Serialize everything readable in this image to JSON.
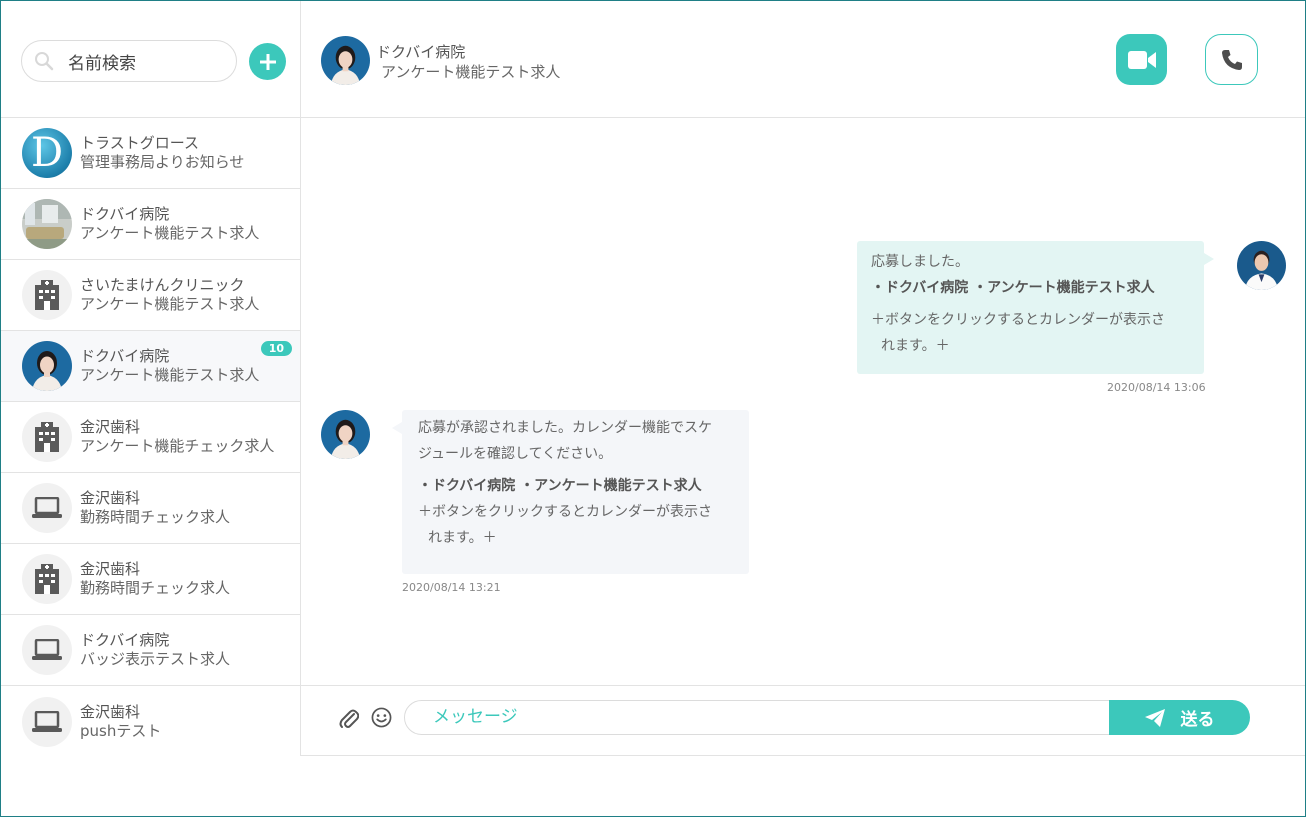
{
  "search": {
    "placeholder": "名前検索"
  },
  "conversations": [
    {
      "name": "トラストグロース",
      "sub": "管理事務局よりお知らせ",
      "avatar": "logo-d"
    },
    {
      "name": "ドクバイ病院",
      "sub": "アンケート機能テスト求人",
      "avatar": "room-photo"
    },
    {
      "name": "さいたまけんクリニック",
      "sub": "アンケート機能テスト求人",
      "avatar": "building-icon"
    },
    {
      "name": "ドクバイ病院",
      "sub": "アンケート機能テスト求人",
      "avatar": "woman-photo",
      "badge": "10",
      "active": true
    },
    {
      "name": "金沢歯科",
      "sub": "アンケート機能チェック求人",
      "avatar": "building-icon"
    },
    {
      "name": "金沢歯科",
      "sub": "勤務時間チェック求人",
      "avatar": "laptop-icon"
    },
    {
      "name": "金沢歯科",
      "sub": "勤務時間チェック求人",
      "avatar": "building-icon"
    },
    {
      "name": "ドクバイ病院",
      "sub": "バッジ表示テスト求人",
      "avatar": "laptop-icon"
    },
    {
      "name": "金沢歯科",
      "sub": "pushテスト",
      "avatar": "laptop-icon"
    }
  ],
  "header": {
    "name": "ドクバイ病院",
    "sub": "アンケート機能テスト求人"
  },
  "messages": {
    "outgoing": {
      "line1": "応募しました。",
      "line2": "・ドクバイ病院 ・アンケート機能テスト求人",
      "line3": "＋ボタンをクリックするとカレンダーが表示さ",
      "line4": "れます。＋",
      "time": "2020/08/14 13:06"
    },
    "incoming": {
      "line1": "応募が承認されました。カレンダー機能でスケ",
      "line2": "ジュールを確認してください。",
      "line3": "・ドクバイ病院 ・アンケート機能テスト求人",
      "line4": "＋ボタンをクリックするとカレンダーが表示さ",
      "line5": "れます。＋",
      "time": "2020/08/14 13:21"
    }
  },
  "composer": {
    "placeholder": "メッセージ",
    "send_label": "送る"
  },
  "colors": {
    "accent": "#3cc8bb",
    "frame": "#1f7f86",
    "outgoing_bubble": "#e3f5f3",
    "incoming_bubble": "#f4f6f9"
  }
}
